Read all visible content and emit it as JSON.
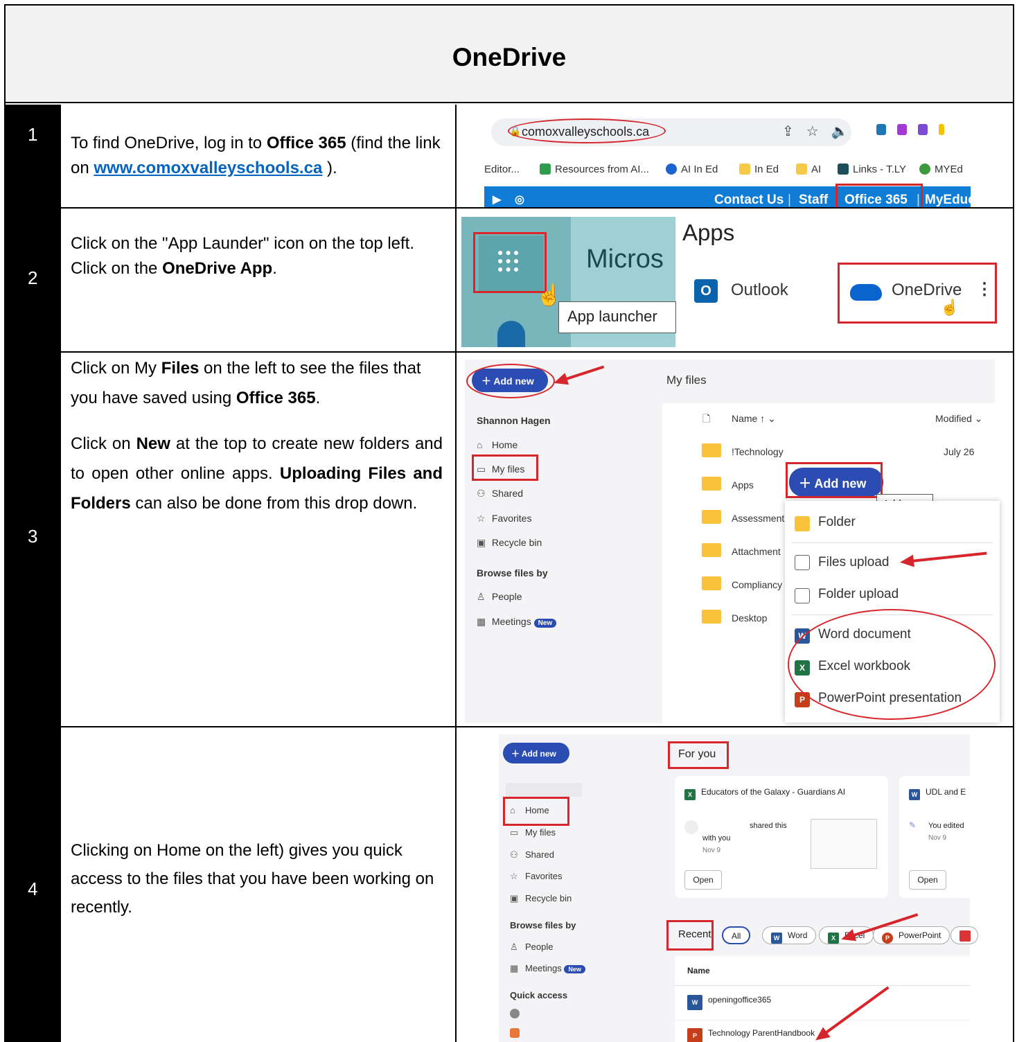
{
  "title": "OneDrive",
  "rows": [
    {
      "num": "1",
      "text_a": "To find OneDrive, log in to ",
      "text_b": "Office 365",
      "text_c": " (find the link on ",
      "link": "www.comoxvalleyschools.ca",
      "text_d": " ).",
      "shot": {
        "url": "comoxvalleyschools.ca",
        "bookmarks": [
          "Editor...",
          "Resources from AI...",
          "AI In Ed",
          "In Ed",
          "AI",
          "Links - T.LY",
          "MYEd"
        ],
        "nav": [
          "Contact Us",
          "Staff",
          "Office 365",
          "MyEduc"
        ]
      }
    },
    {
      "num": "2",
      "line1": "Click on the \"App Launder\" icon on the top left.",
      "line2_a": "Click on the ",
      "line2_b": "OneDrive App",
      "line2_c": ".",
      "shot": {
        "micro": "Micros",
        "tooltip": "App launcher",
        "apps_heading": "Apps",
        "app1": "Outlook",
        "app2": "OneDrive"
      }
    },
    {
      "num": "3",
      "p1_a": "Click on  My ",
      "p1_b": "Files",
      "p1_c": " on the left to see the files that you have saved using ",
      "p1_d": "Office 365",
      "p1_e": ".",
      "p2_a": "Click on ",
      "p2_b": "New",
      "p2_c": " at the top to create new folders and to open other online apps. ",
      "p2_d": "Uploading Files and Folders",
      "p2_e": " can also be done from this drop down.",
      "shot": {
        "add_new": "Add new",
        "user": "Shannon Hagen",
        "nav": [
          "Home",
          "My files",
          "Shared",
          "Favorites",
          "Recycle bin"
        ],
        "browse": "Browse files by",
        "browse_items": [
          "People",
          "Meetings"
        ],
        "new_badge": "New",
        "heading": "My files",
        "col_name": "Name ↑ ⌄",
        "col_modified": "Modified ⌄",
        "folders": [
          "!Technology",
          "Apps",
          "Assessment",
          "Attachment",
          "Compliancy",
          "Desktop"
        ],
        "modified_first": "July 26",
        "menu_button": "Add new",
        "menu_tooltip": "Add new",
        "menu_items": [
          "Folder",
          "Files upload",
          "Folder upload",
          "Word document",
          "Excel workbook",
          "PowerPoint presentation"
        ]
      }
    },
    {
      "num": "4",
      "text": "Clicking on Home on the left) gives you quick access to the files that you have been working on recently.",
      "shot": {
        "add_new": "Add new",
        "nav": [
          "Home",
          "My files",
          "Shared",
          "Favorites",
          "Recycle bin"
        ],
        "browse": "Browse files by",
        "browse_items": [
          "People",
          "Meetings"
        ],
        "new_badge": "New",
        "quick": "Quick access",
        "for_you": "For you",
        "card1_title": "Educators of the Galaxy - Guardians AI",
        "card1_shared": "shared this",
        "card1_with": "with you",
        "card1_date": "Nov 9",
        "card2_title": "UDL and E",
        "card2_edit": "You edited",
        "card2_date": "Nov 9",
        "open": "Open",
        "recent": "Recent",
        "chips": [
          "All",
          "Word",
          "Excel",
          "PowerPoint"
        ],
        "col_name": "Name",
        "files": [
          "openingoffice365",
          "Technology ParentHandbook"
        ]
      }
    }
  ]
}
